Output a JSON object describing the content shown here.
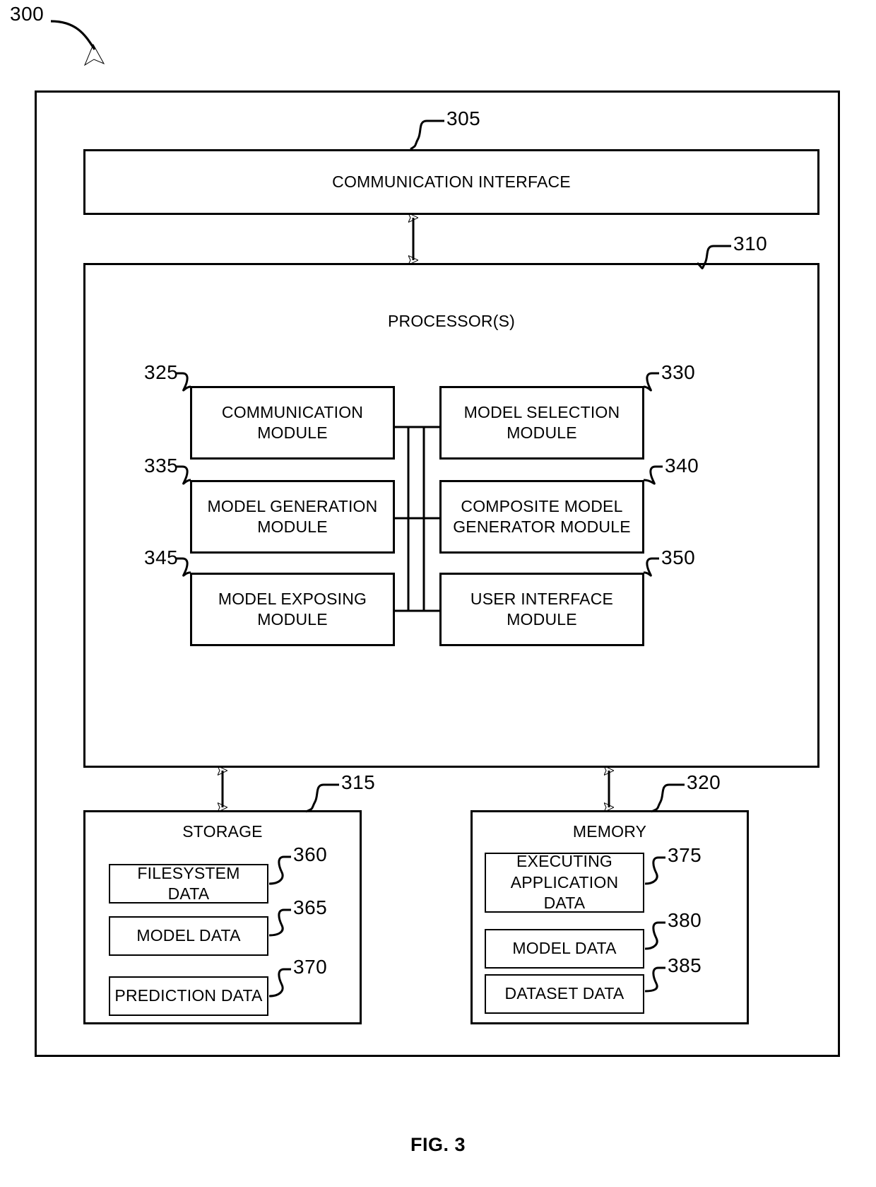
{
  "figure": {
    "caption": "FIG. 3",
    "system_ref": "300"
  },
  "system": {
    "ref": "300",
    "communication_interface": {
      "label": "COMMUNICATION INTERFACE",
      "ref": "305"
    },
    "processor": {
      "label": "PROCESSOR(S)",
      "ref": "310",
      "modules": [
        {
          "ref": "325",
          "label": "COMMUNICATION\nMODULE",
          "column": "left",
          "row": 1
        },
        {
          "ref": "330",
          "label": "MODEL SELECTION\nMODULE",
          "column": "right",
          "row": 1
        },
        {
          "ref": "335",
          "label": "MODEL GENERATION\nMODULE",
          "column": "left",
          "row": 2
        },
        {
          "ref": "340",
          "label": "COMPOSITE MODEL\nGENERATOR MODULE",
          "column": "right",
          "row": 2
        },
        {
          "ref": "345",
          "label": "MODEL EXPOSING\nMODULE",
          "column": "left",
          "row": 3
        },
        {
          "ref": "350",
          "label": "USER INTERFACE\nMODULE",
          "column": "right",
          "row": 3
        }
      ]
    },
    "storage": {
      "label": "STORAGE",
      "ref": "315",
      "items": [
        {
          "ref": "360",
          "label": "FILESYSTEM DATA"
        },
        {
          "ref": "365",
          "label": "MODEL DATA"
        },
        {
          "ref": "370",
          "label": "PREDICTION DATA"
        }
      ]
    },
    "memory": {
      "label": "MEMORY",
      "ref": "320",
      "items": [
        {
          "ref": "375",
          "label": "EXECUTING\nAPPLICATION DATA"
        },
        {
          "ref": "380",
          "label": "MODEL DATA"
        },
        {
          "ref": "385",
          "label": "DATASET DATA"
        }
      ]
    }
  },
  "colors": {
    "stroke": "#000000",
    "background": "#ffffff"
  }
}
